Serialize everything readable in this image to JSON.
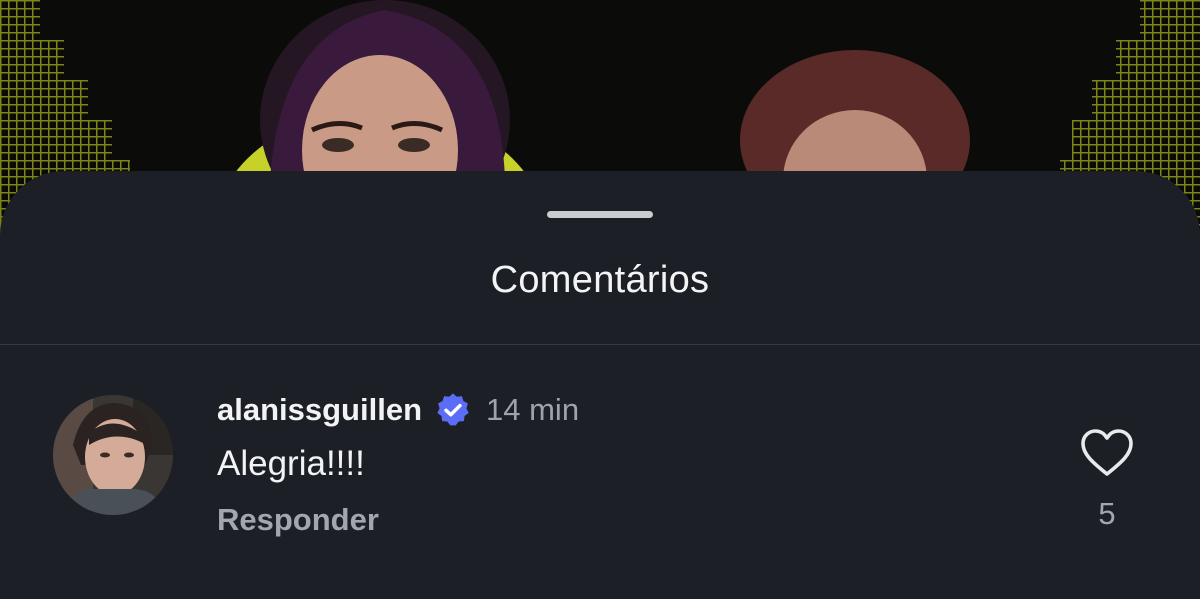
{
  "sheet": {
    "title": "Comentários"
  },
  "comment": {
    "username": "alanissguillen",
    "verified": true,
    "timestamp": "14 min",
    "text": "Alegria!!!!",
    "reply_label": "Responder",
    "like_count": "5",
    "icons": {
      "verified": "verified-badge-icon",
      "like": "heart-outline-icon"
    }
  },
  "colors": {
    "sheet_background": "#1c1f25",
    "verified_badge": "#5b6cf5",
    "accent_yellow": "#c6d22a"
  }
}
